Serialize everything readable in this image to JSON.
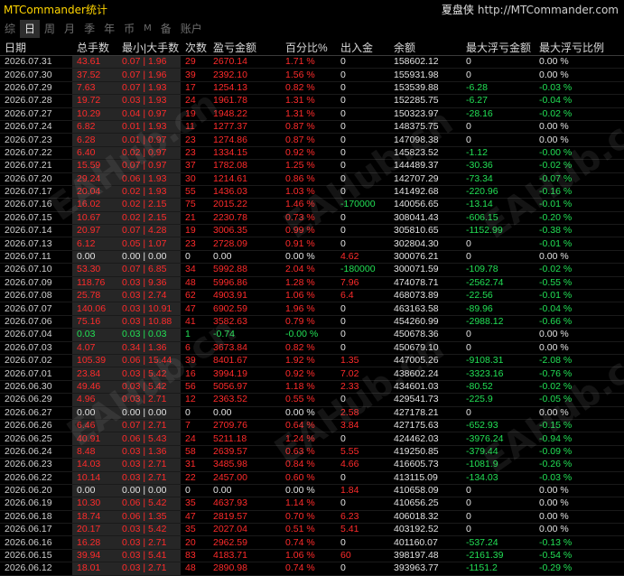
{
  "title": "MTCommander统计",
  "brand": {
    "name": "夏盘侠",
    "url": "http://MTCommander.com"
  },
  "tabs": [
    {
      "label": "综",
      "active": false
    },
    {
      "label": "日",
      "active": true
    },
    {
      "label": "周",
      "active": false
    },
    {
      "label": "月",
      "active": false
    },
    {
      "label": "季",
      "active": false
    },
    {
      "label": "年",
      "active": false
    },
    {
      "label": "币",
      "active": false
    },
    {
      "label": "M",
      "active": false,
      "small": true
    },
    {
      "label": "备",
      "active": false
    },
    {
      "label": "账户",
      "active": false
    }
  ],
  "columns": [
    "日期",
    "总手数",
    "最小|大手数",
    "次数",
    "盈亏金额",
    "百分比%",
    "出入金",
    "余额",
    "最大浮亏金额",
    "最大浮亏比例"
  ],
  "watermark": "EAHub.cn",
  "colors": {
    "profit": "#ff2b2b",
    "loss": "#22e055",
    "title": "#ffd500",
    "tab_active": "#2e2e2e"
  },
  "rows": [
    [
      "2026.07.31",
      "43.61",
      "0.07 | 1.96",
      "29",
      "2670.14",
      "1.71 %",
      "0",
      "158602.12",
      "0",
      "0.00 %"
    ],
    [
      "2026.07.30",
      "37.52",
      "0.07 | 1.96",
      "39",
      "2392.10",
      "1.56 %",
      "0",
      "155931.98",
      "0",
      "0.00 %"
    ],
    [
      "2026.07.29",
      "7.63",
      "0.07 | 1.93",
      "17",
      "1254.13",
      "0.82 %",
      "0",
      "153539.88",
      "-6.28",
      "-0.03 %"
    ],
    [
      "2026.07.28",
      "19.72",
      "0.03 | 1.93",
      "24",
      "1961.78",
      "1.31 %",
      "0",
      "152285.75",
      "-6.27",
      "-0.04 %"
    ],
    [
      "2026.07.27",
      "10.29",
      "0.04 | 0.97",
      "19",
      "1948.22",
      "1.31 %",
      "0",
      "150323.97",
      "-28.16",
      "-0.02 %"
    ],
    [
      "2026.07.24",
      "6.82",
      "0.01 | 1.93",
      "11",
      "1277.37",
      "0.87 %",
      "0",
      "148375.75",
      "0",
      "0.00 %"
    ],
    [
      "2026.07.23",
      "6.28",
      "0.01 | 0.97",
      "23",
      "1274.86",
      "0.87 %",
      "0",
      "147098.38",
      "0",
      "0.00 %"
    ],
    [
      "2026.07.22",
      "6.40",
      "0.02 | 0.97",
      "23",
      "1334.15",
      "0.92 %",
      "0",
      "145823.52",
      "-1.12",
      "-0.00 %"
    ],
    [
      "2026.07.21",
      "15.59",
      "0.07 | 0.97",
      "37",
      "1782.08",
      "1.25 %",
      "0",
      "144489.37",
      "-30.36",
      "-0.02 %"
    ],
    [
      "2026.07.20",
      "29.24",
      "0.06 | 1.93",
      "30",
      "1214.61",
      "0.86 %",
      "0",
      "142707.29",
      "-73.34",
      "-0.07 %"
    ],
    [
      "2026.07.17",
      "20.04",
      "0.02 | 1.93",
      "55",
      "1436.03",
      "1.03 %",
      "0",
      "141492.68",
      "-220.96",
      "-0.16 %"
    ],
    [
      "2026.07.16",
      "16.02",
      "0.02 | 2.15",
      "75",
      "2015.22",
      "1.46 %",
      "-170000",
      "140056.65",
      "-13.14",
      "-0.01 %"
    ],
    [
      "2026.07.15",
      "10.67",
      "0.02 | 2.15",
      "21",
      "2230.78",
      "0.73 %",
      "0",
      "308041.43",
      "-606.15",
      "-0.20 %"
    ],
    [
      "2026.07.14",
      "20.97",
      "0.07 | 4.28",
      "19",
      "3006.35",
      "0.99 %",
      "0",
      "305810.65",
      "-1152.99",
      "-0.38 %"
    ],
    [
      "2026.07.13",
      "6.12",
      "0.05 | 1.07",
      "23",
      "2728.09",
      "0.91 %",
      "0",
      "302804.30",
      "0",
      "-0.01 %"
    ],
    [
      "2026.07.11",
      "0.00",
      "0.00 | 0.00",
      "0",
      "0.00",
      "0.00 %",
      "4.62",
      "300076.21",
      "0",
      "0.00 %"
    ],
    [
      "2026.07.10",
      "53.30",
      "0.07 | 6.85",
      "34",
      "5992.88",
      "2.04 %",
      "-180000",
      "300071.59",
      "-109.78",
      "-0.02 %"
    ],
    [
      "2026.07.09",
      "118.76",
      "0.03 | 9.36",
      "48",
      "5996.86",
      "1.28 %",
      "7.96",
      "474078.71",
      "-2562.74",
      "-0.55 %"
    ],
    [
      "2026.07.08",
      "25.78",
      "0.03 | 2.74",
      "62",
      "4903.91",
      "1.06 %",
      "6.4",
      "468073.89",
      "-22.56",
      "-0.01 %"
    ],
    [
      "2026.07.07",
      "140.06",
      "0.03 | 10.91",
      "47",
      "6902.59",
      "1.96 %",
      "0",
      "463163.58",
      "-89.96",
      "-0.04 %"
    ],
    [
      "2026.07.06",
      "75.16",
      "0.03 | 10.88",
      "41",
      "3582.63",
      "0.79 %",
      "0",
      "454260.99",
      "-2988.12",
      "-0.66 %"
    ],
    [
      "2026.07.04",
      "0.03",
      "0.03 | 0.03",
      "1",
      "-0.74",
      "-0.00 %",
      "0",
      "450678.36",
      "0",
      "0.00 %"
    ],
    [
      "2026.07.03",
      "4.07",
      "0.34 | 1.36",
      "6",
      "3673.84",
      "0.82 %",
      "0",
      "450679.10",
      "0",
      "0.00 %"
    ],
    [
      "2026.07.02",
      "105.39",
      "0.06 | 15.44",
      "39",
      "8401.67",
      "1.92 %",
      "1.35",
      "447005.26",
      "-9108.31",
      "-2.08 %"
    ],
    [
      "2026.07.01",
      "23.84",
      "0.03 | 5.42",
      "16",
      "3994.19",
      "0.92 %",
      "7.02",
      "438602.24",
      "-3323.16",
      "-0.76 %"
    ],
    [
      "2026.06.30",
      "49.46",
      "0.03 | 5.42",
      "56",
      "5056.97",
      "1.18 %",
      "2.33",
      "434601.03",
      "-80.52",
      "-0.02 %"
    ],
    [
      "2026.06.29",
      "4.96",
      "0.03 | 2.71",
      "12",
      "2363.52",
      "0.55 %",
      "0",
      "429541.73",
      "-225.9",
      "-0.05 %"
    ],
    [
      "2026.06.27",
      "0.00",
      "0.00 | 0.00",
      "0",
      "0.00",
      "0.00 %",
      "2.58",
      "427178.21",
      "0",
      "0.00 %"
    ],
    [
      "2026.06.26",
      "6.46",
      "0.07 | 2.71",
      "7",
      "2709.76",
      "0.64 %",
      "3.84",
      "427175.63",
      "-652.93",
      "-0.15 %"
    ],
    [
      "2026.06.25",
      "40.91",
      "0.06 | 5.43",
      "24",
      "5211.18",
      "1.24 %",
      "0",
      "424462.03",
      "-3976.24",
      "-0.94 %"
    ],
    [
      "2026.06.24",
      "8.48",
      "0.03 | 1.36",
      "58",
      "2639.57",
      "0.63 %",
      "5.55",
      "419250.85",
      "-379.44",
      "-0.09 %"
    ],
    [
      "2026.06.23",
      "14.03",
      "0.03 | 2.71",
      "31",
      "3485.98",
      "0.84 %",
      "4.66",
      "416605.73",
      "-1081.9",
      "-0.26 %"
    ],
    [
      "2026.06.22",
      "10.14",
      "0.03 | 2.71",
      "22",
      "2457.00",
      "0.60 %",
      "0",
      "413115.09",
      "-134.03",
      "-0.03 %"
    ],
    [
      "2026.06.20",
      "0.00",
      "0.00 | 0.00",
      "0",
      "0.00",
      "0.00 %",
      "1.84",
      "410658.09",
      "0",
      "0.00 %"
    ],
    [
      "2026.06.19",
      "10.30",
      "0.06 | 5.42",
      "35",
      "4637.93",
      "1.14 %",
      "0",
      "410656.25",
      "0",
      "0.00 %"
    ],
    [
      "2026.06.18",
      "18.74",
      "0.06 | 1.35",
      "47",
      "2819.57",
      "0.70 %",
      "6.23",
      "406018.32",
      "0",
      "0.00 %"
    ],
    [
      "2026.06.17",
      "20.17",
      "0.03 | 5.42",
      "35",
      "2027.04",
      "0.51 %",
      "5.41",
      "403192.52",
      "0",
      "0.00 %"
    ],
    [
      "2026.06.16",
      "16.28",
      "0.03 | 2.71",
      "20",
      "2962.59",
      "0.74 %",
      "0",
      "401160.07",
      "-537.24",
      "-0.13 %"
    ],
    [
      "2026.06.15",
      "39.94",
      "0.03 | 5.41",
      "83",
      "4183.71",
      "1.06 %",
      "60",
      "398197.48",
      "-2161.39",
      "-0.54 %"
    ],
    [
      "2026.06.12",
      "18.01",
      "0.03 | 2.71",
      "48",
      "2890.98",
      "0.74 %",
      "0",
      "393963.77",
      "-1151.2",
      "-0.29 %"
    ]
  ]
}
